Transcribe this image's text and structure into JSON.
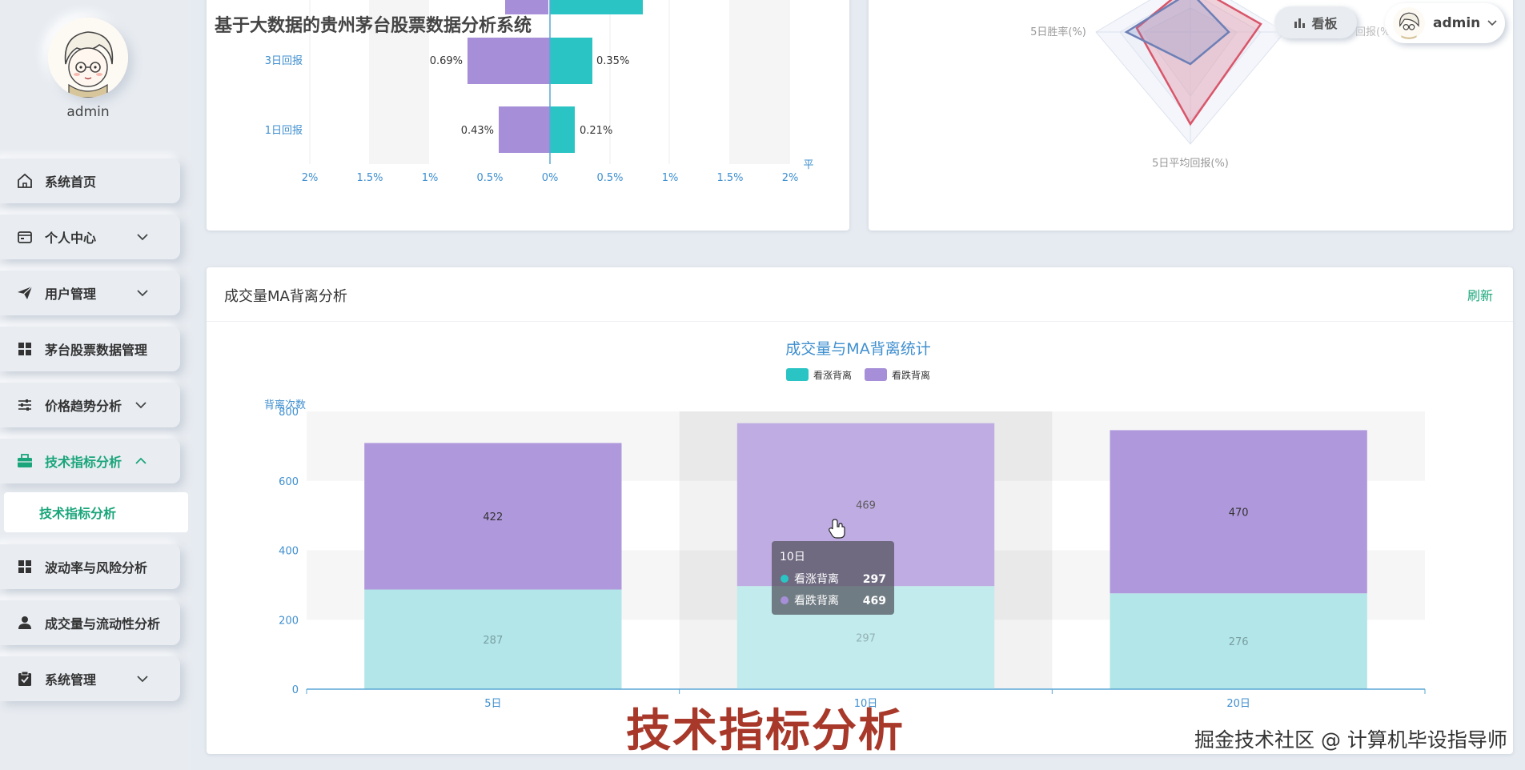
{
  "app_title": "基于大数据的贵州茅台股票数据分析系统",
  "sidebar": {
    "username": "admin",
    "items": [
      {
        "label": "系统首页",
        "icon": "home-icon"
      },
      {
        "label": "个人中心",
        "icon": "wallet-icon"
      },
      {
        "label": "用户管理",
        "icon": "send-icon"
      },
      {
        "label": "茅台股票数据管理",
        "icon": "grid-icon"
      },
      {
        "label": "价格趋势分析",
        "icon": "sliders-icon"
      },
      {
        "label": "技术指标分析",
        "icon": "briefcase-icon"
      },
      {
        "label": "波动率与风险分析",
        "icon": "grid-icon"
      },
      {
        "label": "成交量与流动性分析",
        "icon": "user-icon"
      },
      {
        "label": "系统管理",
        "icon": "clipboard-icon"
      }
    ],
    "submenu": {
      "label": "技术指标分析"
    }
  },
  "header": {
    "dashboard_label": "看板",
    "user_label": "admin"
  },
  "top_left_chart": {
    "row_labels": [
      "3日回报",
      "1日回报"
    ],
    "left_values": [
      "0.69%",
      "0.43%"
    ],
    "right_values": [
      "0.35%",
      "0.21%"
    ],
    "ticks": [
      "2%",
      "1.5%",
      "1%",
      "0.5%",
      "0%",
      "0.5%",
      "1%",
      "1.5%",
      "2%"
    ],
    "axis_end_label": "平"
  },
  "radar_chart": {
    "labels": [
      "5日胜率(%)",
      "5日平均回报(%)",
      "回报(%"
    ]
  },
  "bottom_card": {
    "title": "成交量MA背离分析",
    "refresh_label": "刷新"
  },
  "tooltip": {
    "title": "10日",
    "rows": [
      {
        "name": "看涨背离",
        "value": "297",
        "color": "#2bc4c4"
      },
      {
        "name": "看跌背离",
        "value": "469",
        "color": "#a68fd8"
      }
    ]
  },
  "chart_data": {
    "type": "bar",
    "title": "成交量与MA背离统计",
    "ylabel": "背离次数",
    "xlabel": "",
    "categories": [
      "5日",
      "10日",
      "20日"
    ],
    "ylim": [
      0,
      800
    ],
    "yticks": [
      "0",
      "200",
      "400",
      "600",
      "800"
    ],
    "stacked": true,
    "series": [
      {
        "name": "看涨背离",
        "values": [
          287,
          297,
          276
        ],
        "color": "#b2e6e8",
        "legend_color": "#2bc4c4"
      },
      {
        "name": "看跌背离",
        "values": [
          422,
          469,
          470
        ],
        "color": "#af98dc",
        "legend_color": "#a68fd8"
      }
    ],
    "legend_position": "top-center",
    "highlighted_category": "10日"
  },
  "overlay": {
    "watermark": "技术指标分析",
    "credit": "掘金技术社区 @ 计算机毕设指导师"
  }
}
